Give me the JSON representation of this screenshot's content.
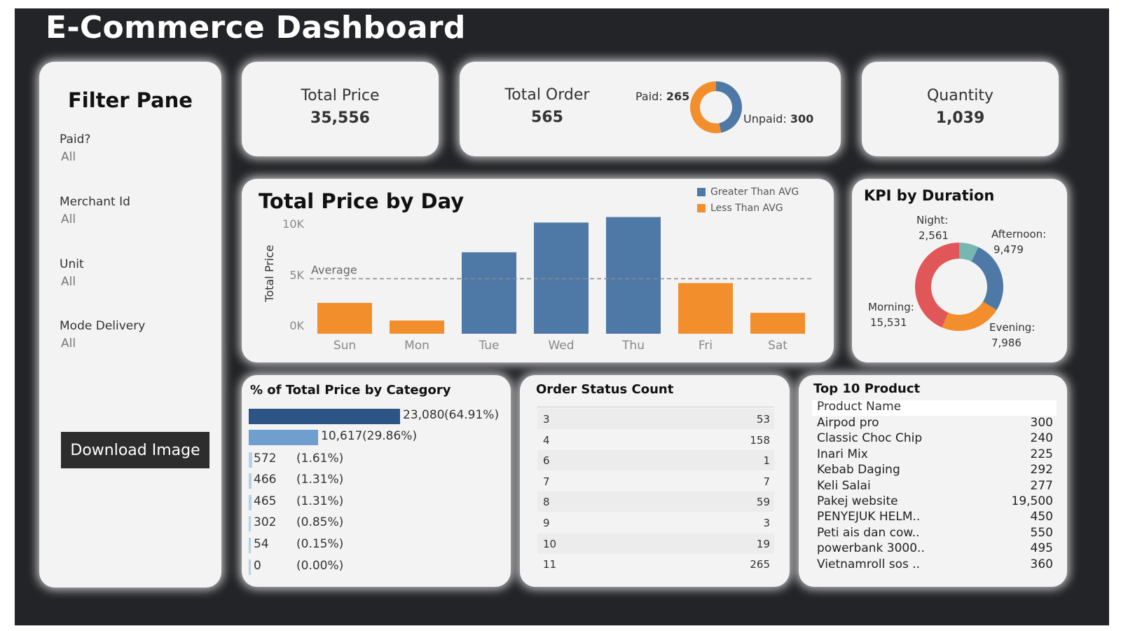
{
  "title": "E-Commerce Dashboard",
  "colors": {
    "above_avg": "#4e79a7",
    "below_avg": "#f28e2b",
    "paid": "#4e79a7",
    "unpaid": "#f28e2b",
    "morning": "#e15759",
    "afternoon": "#4e79a7",
    "evening": "#f28e2b",
    "night": "#76b7b2",
    "cat_dark": "#2c5585",
    "cat_mid": "#6e9fcf",
    "cat_light": "#b5d1ea"
  },
  "filter_pane": {
    "title": "Filter Pane",
    "filters": [
      {
        "label": "Paid?",
        "value": "All"
      },
      {
        "label": "Merchant Id",
        "value": "All"
      },
      {
        "label": "Unit",
        "value": "All"
      },
      {
        "label": "Mode Delivery",
        "value": "All"
      }
    ],
    "download_label": "Download Image"
  },
  "kpis": {
    "total_price": {
      "label": "Total Price",
      "value": "35,556"
    },
    "total_order": {
      "label": "Total Order",
      "value": "565",
      "paid_label": "Paid:",
      "paid_value": "265",
      "unpaid_label": "Unpaid:",
      "unpaid_value": "300"
    },
    "quantity": {
      "label": "Quantity",
      "value": "1,039"
    }
  },
  "chart_data": [
    {
      "type": "bar",
      "title": "Total Price by Day",
      "ylabel": "Total Price",
      "xlabel": "",
      "categories": [
        "Sun",
        "Mon",
        "Tue",
        "Wed",
        "Thu",
        "Fri",
        "Sat"
      ],
      "values": [
        2800,
        1200,
        7400,
        10100,
        10600,
        4600,
        1900
      ],
      "ylim": [
        0,
        10000
      ],
      "yticks": [
        "0K",
        "5K",
        "10K"
      ],
      "reference_line": {
        "label": "Average",
        "value": 5000
      },
      "legend": [
        "Greater Than AVG",
        "Less Than AVG"
      ],
      "grid": false
    },
    {
      "type": "pie",
      "title": "KPI by Duration",
      "labels": [
        "Night:",
        "Afternoon:",
        "Evening:",
        "Morning:"
      ],
      "values": [
        2561,
        9479,
        7986,
        15531
      ],
      "value_labels": [
        "2,561",
        "9,479",
        "7,986",
        "15,531"
      ]
    },
    {
      "type": "pie",
      "title": "",
      "labels": [
        "Paid:",
        "Unpaid:"
      ],
      "values": [
        265,
        300
      ]
    }
  ],
  "category": {
    "title": "% of Total Price by Category",
    "rows": [
      {
        "value": "23,080",
        "pct": "(64.91%)",
        "share": 0.6491
      },
      {
        "value": "10,617",
        "pct": "(29.86%)",
        "share": 0.2986
      },
      {
        "value": "572",
        "pct": "(1.61%)",
        "share": 0.0161
      },
      {
        "value": "466",
        "pct": "(1.31%)",
        "share": 0.0131
      },
      {
        "value": "465",
        "pct": "(1.31%)",
        "share": 0.0131
      },
      {
        "value": "302",
        "pct": "(0.85%)",
        "share": 0.0085
      },
      {
        "value": "54",
        "pct": "(0.15%)",
        "share": 0.0015
      },
      {
        "value": "0",
        "pct": "(0.00%)",
        "share": 0
      }
    ]
  },
  "order_status": {
    "title": "Order Status Count",
    "rows": [
      {
        "status": "3",
        "count": "53"
      },
      {
        "status": "4",
        "count": "158"
      },
      {
        "status": "6",
        "count": "1"
      },
      {
        "status": "7",
        "count": "7"
      },
      {
        "status": "8",
        "count": "59"
      },
      {
        "status": "9",
        "count": "3"
      },
      {
        "status": "10",
        "count": "19"
      },
      {
        "status": "11",
        "count": "265"
      }
    ]
  },
  "top_products": {
    "title": "Top 10 Product",
    "header": "Product Name",
    "rows": [
      {
        "name": "Airpod pro",
        "value": "300"
      },
      {
        "name": "Classic Choc Chip",
        "value": "240"
      },
      {
        "name": "Inari Mix",
        "value": "225"
      },
      {
        "name": "Kebab Daging",
        "value": "292"
      },
      {
        "name": "Keli Salai",
        "value": "277"
      },
      {
        "name": "Pakej website",
        "value": "19,500"
      },
      {
        "name": "PENYEJUK HELM..",
        "value": "450"
      },
      {
        "name": "Peti ais dan cow..",
        "value": "550"
      },
      {
        "name": "powerbank 3000..",
        "value": "495"
      },
      {
        "name": "Vietnamroll  sos ..",
        "value": "360"
      }
    ]
  }
}
